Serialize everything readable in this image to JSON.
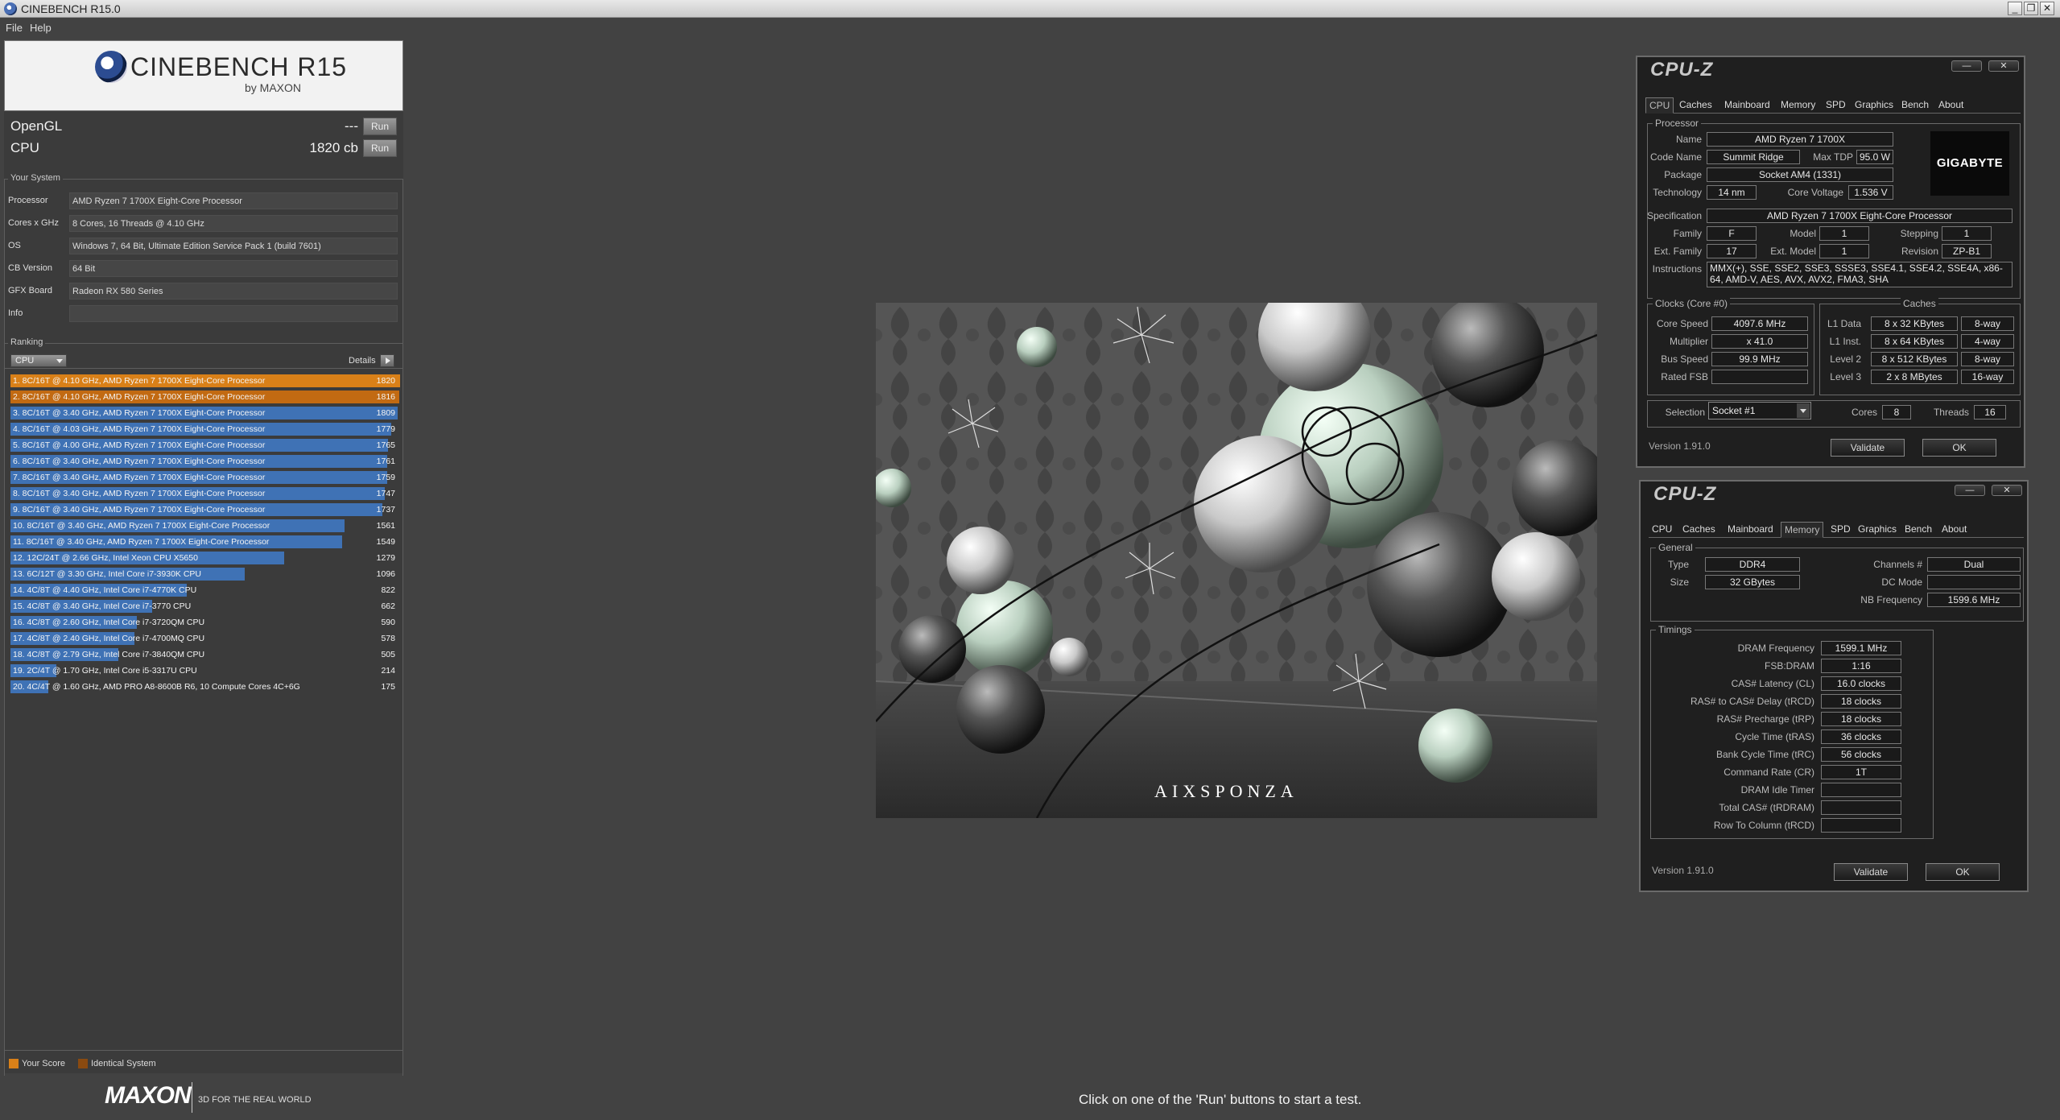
{
  "window": {
    "title": "CINEBENCH R15.0"
  },
  "menu": {
    "file": "File",
    "help": "Help"
  },
  "logo": {
    "title": "CINEBENCH R15",
    "by": "by MAXON"
  },
  "tests": [
    {
      "label": "OpenGL",
      "value": "---",
      "run": "Run"
    },
    {
      "label": "CPU",
      "value": "1820 cb",
      "run": "Run"
    }
  ],
  "system": {
    "legend": "Your System",
    "rows": [
      {
        "key": "Processor",
        "value": "AMD Ryzen 7 1700X Eight-Core Processor"
      },
      {
        "key": "Cores x GHz",
        "value": "8 Cores, 16 Threads @ 4.10 GHz"
      },
      {
        "key": "OS",
        "value": "Windows 7, 64 Bit, Ultimate Edition Service Pack 1 (build 7601)"
      },
      {
        "key": "CB Version",
        "value": "64 Bit"
      },
      {
        "key": "GFX Board",
        "value": "Radeon RX 580 Series"
      },
      {
        "key": "Info",
        "value": ""
      }
    ]
  },
  "ranking": {
    "legend": "Ranking",
    "select": "CPU",
    "details": "Details",
    "max_score": 1820,
    "rows": [
      {
        "label": "1. 8C/16T @ 4.10 GHz, AMD Ryzen 7 1700X Eight-Core Processor",
        "score": 1820,
        "kind": "you"
      },
      {
        "label": "2. 8C/16T @ 4.10 GHz, AMD Ryzen 7 1700X Eight-Core Processor",
        "score": 1816,
        "kind": "identical"
      },
      {
        "label": "3. 8C/16T @ 3.40 GHz, AMD Ryzen 7 1700X Eight-Core Processor",
        "score": 1809,
        "kind": "other"
      },
      {
        "label": "4. 8C/16T @ 4.03 GHz, AMD Ryzen 7 1700X Eight-Core Processor",
        "score": 1779,
        "kind": "other"
      },
      {
        "label": "5. 8C/16T @ 4.00 GHz, AMD Ryzen 7 1700X Eight-Core Processor",
        "score": 1765,
        "kind": "other"
      },
      {
        "label": "6. 8C/16T @ 3.40 GHz, AMD Ryzen 7 1700X Eight-Core Processor",
        "score": 1761,
        "kind": "other"
      },
      {
        "label": "7. 8C/16T @ 3.40 GHz, AMD Ryzen 7 1700X Eight-Core Processor",
        "score": 1759,
        "kind": "other"
      },
      {
        "label": "8. 8C/16T @ 3.40 GHz, AMD Ryzen 7 1700X Eight-Core Processor",
        "score": 1747,
        "kind": "other"
      },
      {
        "label": "9. 8C/16T @ 3.40 GHz, AMD Ryzen 7 1700X Eight-Core Processor",
        "score": 1737,
        "kind": "other"
      },
      {
        "label": "10. 8C/16T @ 3.40 GHz, AMD Ryzen 7 1700X Eight-Core Processor",
        "score": 1561,
        "kind": "other"
      },
      {
        "label": "11. 8C/16T @ 3.40 GHz, AMD Ryzen 7 1700X Eight-Core Processor",
        "score": 1549,
        "kind": "other"
      },
      {
        "label": "12. 12C/24T @ 2.66 GHz, Intel Xeon CPU X5650",
        "score": 1279,
        "kind": "other"
      },
      {
        "label": "13. 6C/12T @ 3.30 GHz,  Intel Core i7-3930K CPU",
        "score": 1096,
        "kind": "other"
      },
      {
        "label": "14. 4C/8T @ 4.40 GHz, Intel Core i7-4770K CPU",
        "score": 822,
        "kind": "other"
      },
      {
        "label": "15. 4C/8T @ 3.40 GHz,  Intel Core i7-3770 CPU",
        "score": 662,
        "kind": "other"
      },
      {
        "label": "16. 4C/8T @ 2.60 GHz, Intel Core i7-3720QM CPU",
        "score": 590,
        "kind": "other"
      },
      {
        "label": "17. 4C/8T @ 2.40 GHz, Intel Core i7-4700MQ CPU",
        "score": 578,
        "kind": "other"
      },
      {
        "label": "18. 4C/8T @ 2.79 GHz,  Intel Core i7-3840QM CPU",
        "score": 505,
        "kind": "other"
      },
      {
        "label": "19. 2C/4T @ 1.70 GHz,  Intel Core i5-3317U CPU",
        "score": 214,
        "kind": "other"
      },
      {
        "label": "20. 4C/4T @ 1.60 GHz, AMD PRO A8-8600B R6, 10 Compute Cores 4C+6G",
        "score": 175,
        "kind": "other"
      }
    ],
    "legend_your": "Your Score",
    "legend_identical": "Identical System"
  },
  "colors": {
    "your_score": "#d98018",
    "identical": "#8a4a10",
    "other": "#3f72b5"
  },
  "footer": {
    "brand": "MAXON",
    "tagline": "3D FOR THE REAL WORLD",
    "status": "Click on one of the 'Run' buttons to start a test."
  },
  "render": {
    "watermark": "AIXSPONZA"
  },
  "cpuz1": {
    "title": "CPU-Z",
    "tabs": [
      "CPU",
      "Caches",
      "Mainboard",
      "Memory",
      "SPD",
      "Graphics",
      "Bench",
      "About"
    ],
    "active_tab": "CPU",
    "processor_legend": "Processor",
    "name_label": "Name",
    "name": "AMD Ryzen 7 1700X",
    "codename_label": "Code Name",
    "codename": "Summit Ridge",
    "maxtdp_label": "Max TDP",
    "maxtdp": "95.0 W",
    "package_label": "Package",
    "package": "Socket AM4 (1331)",
    "technology_label": "Technology",
    "technology": "14 nm",
    "corevoltage_label": "Core Voltage",
    "corevoltage": "1.536 V",
    "brand_logo": "GIGABYTE",
    "spec_label": "Specification",
    "spec": "AMD Ryzen 7 1700X Eight-Core Processor",
    "family_label": "Family",
    "family": "F",
    "model_label": "Model",
    "model": "1",
    "stepping_label": "Stepping",
    "stepping": "1",
    "extfamily_label": "Ext. Family",
    "extfamily": "17",
    "extmodel_label": "Ext. Model",
    "extmodel": "1",
    "revision_label": "Revision",
    "revision": "ZP-B1",
    "instructions_label": "Instructions",
    "instructions": "MMX(+), SSE, SSE2, SSE3, SSSE3, SSE4.1, SSE4.2, SSE4A, x86-64, AMD-V, AES, AVX, AVX2, FMA3, SHA",
    "clocks_legend": "Clocks (Core #0)",
    "corespeed_label": "Core Speed",
    "corespeed": "4097.6 MHz",
    "multiplier_label": "Multiplier",
    "multiplier": "x 41.0",
    "busspeed_label": "Bus Speed",
    "busspeed": "99.9 MHz",
    "ratedfsb_label": "Rated FSB",
    "ratedfsb": "",
    "caches_legend": "Caches",
    "l1d_label": "L1 Data",
    "l1d": "8 x 32 KBytes",
    "l1d_way": "8-way",
    "l1i_label": "L1 Inst.",
    "l1i": "8 x 64 KBytes",
    "l1i_way": "4-way",
    "l2_label": "Level 2",
    "l2": "8 x 512 KBytes",
    "l2_way": "8-way",
    "l3_label": "Level 3",
    "l3": "2 x 8 MBytes",
    "l3_way": "16-way",
    "selection_label": "Selection",
    "selection": "Socket #1",
    "cores_label": "Cores",
    "cores": "8",
    "threads_label": "Threads",
    "threads": "16",
    "version": "Version 1.91.0",
    "validate": "Validate",
    "ok": "OK"
  },
  "cpuz2": {
    "title": "CPU-Z",
    "tabs": [
      "CPU",
      "Caches",
      "Mainboard",
      "Memory",
      "SPD",
      "Graphics",
      "Bench",
      "About"
    ],
    "active_tab": "Memory",
    "general_legend": "General",
    "type_label": "Type",
    "type": "DDR4",
    "size_label": "Size",
    "size": "32 GBytes",
    "channels_label": "Channels #",
    "channels": "Dual",
    "dcmode_label": "DC Mode",
    "dcmode": "",
    "nbfreq_label": "NB Frequency",
    "nbfreq": "1599.6 MHz",
    "timings_legend": "Timings",
    "timings": [
      {
        "label": "DRAM Frequency",
        "value": "1599.1 MHz"
      },
      {
        "label": "FSB:DRAM",
        "value": "1:16"
      },
      {
        "label": "CAS# Latency (CL)",
        "value": "16.0 clocks"
      },
      {
        "label": "RAS# to CAS# Delay (tRCD)",
        "value": "18 clocks"
      },
      {
        "label": "RAS# Precharge (tRP)",
        "value": "18 clocks"
      },
      {
        "label": "Cycle Time (tRAS)",
        "value": "36 clocks"
      },
      {
        "label": "Bank Cycle Time (tRC)",
        "value": "56 clocks"
      },
      {
        "label": "Command Rate (CR)",
        "value": "1T"
      },
      {
        "label": "DRAM Idle Timer",
        "value": ""
      },
      {
        "label": "Total CAS# (tRDRAM)",
        "value": ""
      },
      {
        "label": "Row To Column (tRCD)",
        "value": ""
      }
    ],
    "version": "Version 1.91.0",
    "validate": "Validate",
    "ok": "OK"
  }
}
